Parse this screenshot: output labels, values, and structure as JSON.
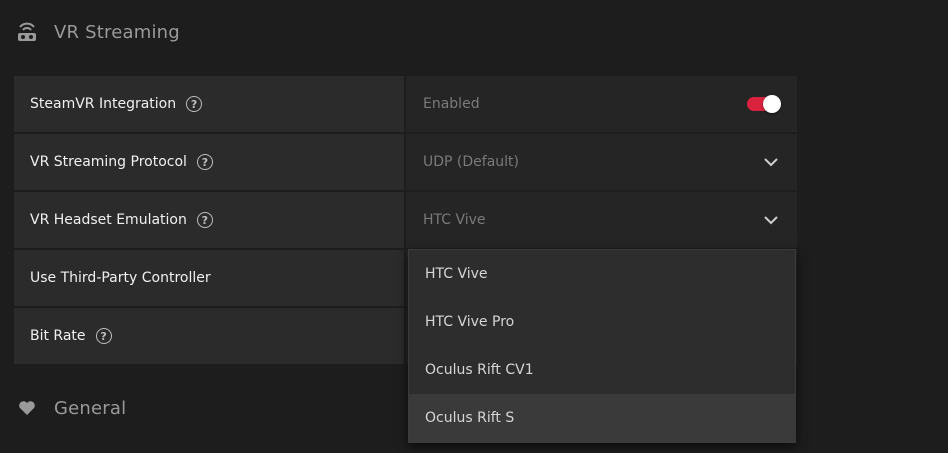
{
  "sections": {
    "vr_streaming": {
      "title": "VR Streaming",
      "icon": "vr-headset-icon"
    },
    "general": {
      "title": "General",
      "icon": "heart-icon"
    }
  },
  "settings": {
    "steamvr": {
      "label": "SteamVR Integration",
      "help": "?",
      "value": "Enabled",
      "toggle_on": true
    },
    "protocol": {
      "label": "VR Streaming Protocol",
      "help": "?",
      "value": "UDP (Default)"
    },
    "headset": {
      "label": "VR Headset Emulation",
      "help": "?",
      "value": "HTC Vive"
    },
    "controller": {
      "label": "Use Third-Party Controller"
    },
    "bitrate": {
      "label": "Bit Rate",
      "help": "?"
    }
  },
  "dropdown": {
    "options": [
      "HTC Vive",
      "HTC Vive Pro",
      "Oculus Rift CV1",
      "Oculus Rift S"
    ],
    "highlighted": "Oculus Rift S"
  },
  "colors": {
    "accent": "#d9233e",
    "background": "#1d1d1d",
    "label_bg": "#2b2b2b",
    "value_bg": "#252525"
  }
}
